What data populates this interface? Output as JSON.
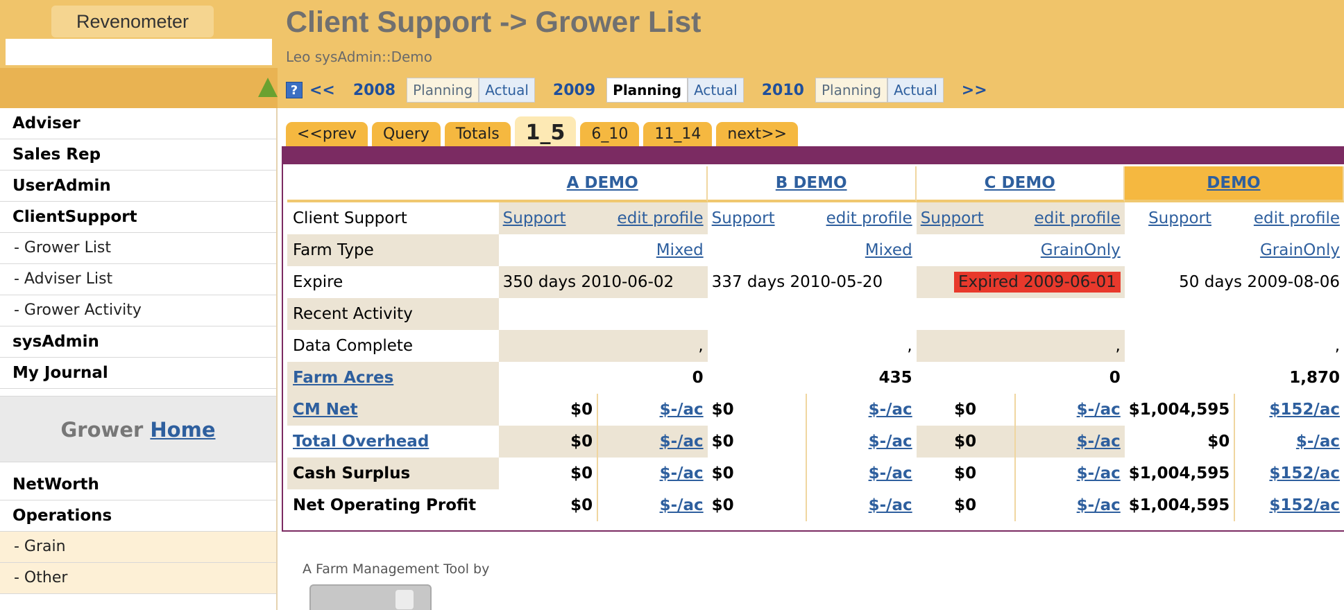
{
  "brand": {
    "title": "Revenometer"
  },
  "header": {
    "title": "Client Support -> Grower List",
    "user": "Leo sysAdmin::Demo",
    "help_icon": "?",
    "prev": "<<",
    "next": ">>",
    "years": [
      {
        "year": "2008",
        "planning": "Planning",
        "actual": "Actual"
      },
      {
        "year": "2009",
        "planning": "Planning",
        "actual": "Actual"
      },
      {
        "year": "2010",
        "planning": "Planning",
        "actual": "Actual"
      }
    ]
  },
  "sidebar": {
    "items": [
      {
        "label": "Adviser"
      },
      {
        "label": "Sales Rep"
      },
      {
        "label": "UserAdmin"
      },
      {
        "label": "ClientSupport"
      },
      {
        "label": "- Grower List"
      },
      {
        "label": "- Adviser List"
      },
      {
        "label": "- Grower Activity"
      },
      {
        "label": "sysAdmin"
      },
      {
        "label": "My Journal"
      }
    ],
    "grower_home_prefix": "Grower",
    "grower_home_link": "Home",
    "lower_items": [
      {
        "label": "NetWorth"
      },
      {
        "label": "Operations"
      },
      {
        "label": "- Grain"
      },
      {
        "label": "- Other"
      }
    ]
  },
  "tabs": [
    "<<prev",
    "Query",
    "Totals",
    "1_5",
    "6_10",
    "11_14",
    "next>>"
  ],
  "grid": {
    "growers": [
      "A DEMO",
      "B DEMO",
      "C DEMO",
      "DEMO"
    ],
    "support_link": "Support",
    "edit_link": "edit profile",
    "rows": {
      "client_support": "Client Support",
      "farm_type": "Farm Type",
      "expire": "Expire",
      "recent_activity": "Recent Activity",
      "data_complete": "Data Complete",
      "farm_acres": "Farm Acres",
      "cm_net": "CM Net",
      "total_overhead": "Total Overhead",
      "cash_surplus": "Cash Surplus",
      "net_operating_profit": "Net Operating Profit"
    },
    "farm_types": [
      "Mixed",
      "Mixed",
      "GrainOnly",
      "GrainOnly"
    ],
    "expires": [
      "350 days 2010-06-02",
      "337 days 2010-05-20",
      "Expired 2009-06-01",
      "50 days 2009-08-06"
    ],
    "data_complete": [
      ",",
      ",",
      ",",
      ","
    ],
    "acres": [
      "0",
      "435",
      "0",
      "1,870"
    ],
    "cm_net": [
      [
        "$0",
        "$-/ac"
      ],
      [
        "$0",
        "$-/ac"
      ],
      [
        "$0",
        "$-/ac"
      ],
      [
        "$1,004,595",
        "$152/ac"
      ]
    ],
    "total_overhead": [
      [
        "$0",
        "$-/ac"
      ],
      [
        "$0",
        "$-/ac"
      ],
      [
        "$0",
        "$-/ac"
      ],
      [
        "$0",
        "$-/ac"
      ]
    ],
    "cash_surplus": [
      [
        "$0",
        "$-/ac"
      ],
      [
        "$0",
        "$-/ac"
      ],
      [
        "$0",
        "$-/ac"
      ],
      [
        "$1,004,595",
        "$152/ac"
      ]
    ],
    "net_operating_profit": [
      [
        "$0",
        "$-/ac"
      ],
      [
        "$0",
        "$-/ac"
      ],
      [
        "$0",
        "$-/ac"
      ],
      [
        "$1,004,595",
        "$152/ac"
      ]
    ]
  },
  "footer": {
    "text": "A Farm Management Tool by"
  },
  "colors": {
    "header_bg": "#f0c46a",
    "accent_purple": "#7b2b62",
    "tab_orange": "#f5b840",
    "expired_red": "#e8392c",
    "link_blue": "#2e5f9e"
  }
}
